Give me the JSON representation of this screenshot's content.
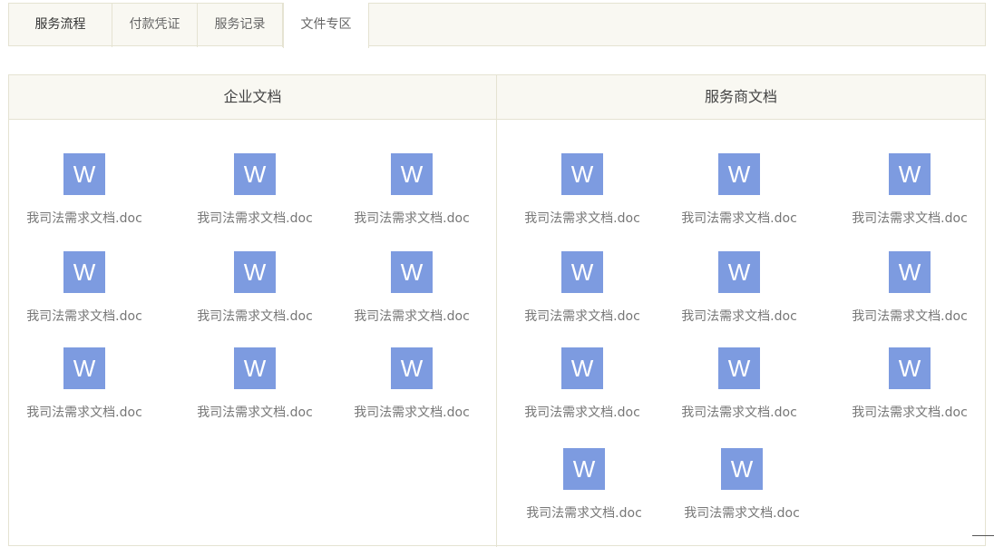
{
  "tabs": [
    {
      "label": "服务流程"
    },
    {
      "label": "付款凭证"
    },
    {
      "label": "服务记录"
    },
    {
      "label": "文件专区"
    }
  ],
  "enterprise_docs": {
    "title": "企业文档",
    "files": [
      {
        "icon": "W",
        "name": "我司法需求文档.doc"
      },
      {
        "icon": "W",
        "name": "我司法需求文档.doc"
      },
      {
        "icon": "W",
        "name": "我司法需求文档.doc"
      },
      {
        "icon": "W",
        "name": "我司法需求文档.doc"
      },
      {
        "icon": "W",
        "name": "我司法需求文档.doc"
      },
      {
        "icon": "W",
        "name": "我司法需求文档.doc"
      },
      {
        "icon": "W",
        "name": "我司法需求文档.doc"
      },
      {
        "icon": "W",
        "name": "我司法需求文档.doc"
      },
      {
        "icon": "W",
        "name": "我司法需求文档.doc"
      }
    ]
  },
  "provider_docs": {
    "title": "服务商文档",
    "files": [
      {
        "icon": "W",
        "name": "我司法需求文档.doc"
      },
      {
        "icon": "W",
        "name": "我司法需求文档.doc"
      },
      {
        "icon": "W",
        "name": "我司法需求文档.doc"
      },
      {
        "icon": "W",
        "name": "我司法需求文档.doc"
      },
      {
        "icon": "W",
        "name": "我司法需求文档.doc"
      },
      {
        "icon": "W",
        "name": "我司法需求文档.doc"
      },
      {
        "icon": "W",
        "name": "我司法需求文档.doc"
      },
      {
        "icon": "W",
        "name": "我司法需求文档.doc"
      },
      {
        "icon": "W",
        "name": "我司法需求文档.doc"
      },
      {
        "icon": "W",
        "name": "我司法需求文档.doc"
      },
      {
        "icon": "W",
        "name": "我司法需求文档.doc"
      }
    ]
  },
  "colors": {
    "word_icon": "#7d9be0",
    "border": "#e5e3d2",
    "header_bg": "#f9f8f2"
  }
}
